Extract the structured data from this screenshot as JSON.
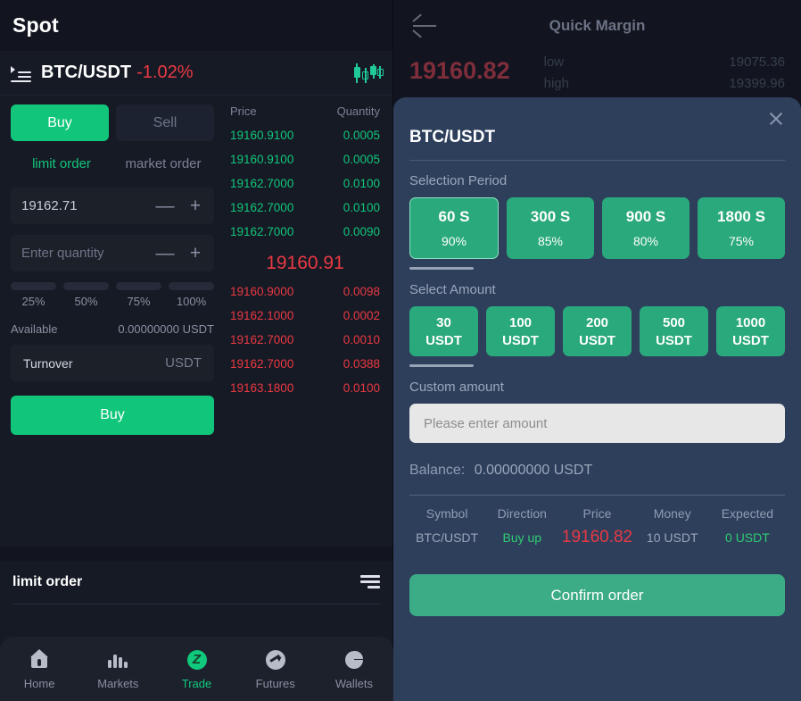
{
  "left": {
    "header_title": "Spot",
    "pair": {
      "name": "BTC/USDT",
      "change": "-1.02%",
      "list_icon": "list-icon",
      "chart_icon": "candlestick-icon"
    },
    "side_tabs": {
      "buy": "Buy",
      "sell": "Sell"
    },
    "order_types": {
      "limit": "limit order",
      "market": "market order"
    },
    "price_input": {
      "value": "19162.71",
      "minus": "—",
      "plus": "+"
    },
    "quantity_input": {
      "placeholder": "Enter quantity",
      "minus": "—",
      "plus": "+"
    },
    "percents": [
      "25%",
      "50%",
      "75%",
      "100%"
    ],
    "available": {
      "label": "Available",
      "value": "0.00000000 USDT"
    },
    "turnover": {
      "label": "Turnover",
      "unit": "USDT"
    },
    "submit_label": "Buy",
    "orderbook": {
      "col_price": "Price",
      "col_quantity": "Quantity",
      "asks": [
        {
          "price": "19160.9100",
          "qty": "0.0005"
        },
        {
          "price": "19160.9100",
          "qty": "0.0005"
        },
        {
          "price": "19162.7000",
          "qty": "0.0100"
        },
        {
          "price": "19162.7000",
          "qty": "0.0100"
        },
        {
          "price": "19162.7000",
          "qty": "0.0090"
        }
      ],
      "mid_price": "19160.91",
      "bids": [
        {
          "price": "19160.9000",
          "qty": "0.0098"
        },
        {
          "price": "19162.1000",
          "qty": "0.0002"
        },
        {
          "price": "19162.7000",
          "qty": "0.0010"
        },
        {
          "price": "19162.7000",
          "qty": "0.0388"
        },
        {
          "price": "19163.1800",
          "qty": "0.0100"
        }
      ]
    },
    "orders_section": {
      "title": "limit order",
      "filter_icon": "filter-icon"
    },
    "bottom_nav": [
      {
        "label": "Home",
        "icon": "home-icon"
      },
      {
        "label": "Markets",
        "icon": "bar-chart-icon"
      },
      {
        "label": "Trade",
        "icon": "trade-icon"
      },
      {
        "label": "Futures",
        "icon": "trend-up-icon"
      },
      {
        "label": "Wallets",
        "icon": "pie-chart-icon"
      }
    ]
  },
  "right": {
    "header": {
      "title": "Quick Margin",
      "back_icon": "back-arrow-icon"
    },
    "stats": {
      "price": "19160.82",
      "low_label": "low",
      "low_value": "19075.36",
      "high_label": "high",
      "high_value": "19399.96"
    },
    "modal": {
      "title": "BTC/USDT",
      "close_icon": "close-icon",
      "period_label": "Selection Period",
      "periods": [
        {
          "duration": "60 S",
          "rate": "90%",
          "selected": true
        },
        {
          "duration": "300 S",
          "rate": "85%",
          "selected": false
        },
        {
          "duration": "900 S",
          "rate": "80%",
          "selected": false
        },
        {
          "duration": "1800 S",
          "rate": "75%",
          "selected": false
        }
      ],
      "amount_label": "Select Amount",
      "amounts": [
        {
          "value": "30",
          "unit": "USDT"
        },
        {
          "value": "100",
          "unit": "USDT"
        },
        {
          "value": "200",
          "unit": "USDT"
        },
        {
          "value": "500",
          "unit": "USDT"
        },
        {
          "value": "1000",
          "unit": "USDT"
        }
      ],
      "custom_label": "Custom amount",
      "custom_placeholder": "Please enter amount",
      "balance_label": "Balance:",
      "balance_value": "0.00000000 USDT",
      "summary_headers": [
        "Symbol",
        "Direction",
        "Price",
        "Money",
        "Expected"
      ],
      "summary_values": {
        "symbol": "BTC/USDT",
        "direction": "Buy up",
        "price": "19160.82",
        "money": "10 USDT",
        "expected": "0 USDT"
      },
      "confirm_label": "Confirm order"
    }
  },
  "colors": {
    "green": "#11c67a",
    "red": "#ea3943",
    "modal_bg": "#2e3f5c",
    "chip_green": "#2aa97c"
  }
}
